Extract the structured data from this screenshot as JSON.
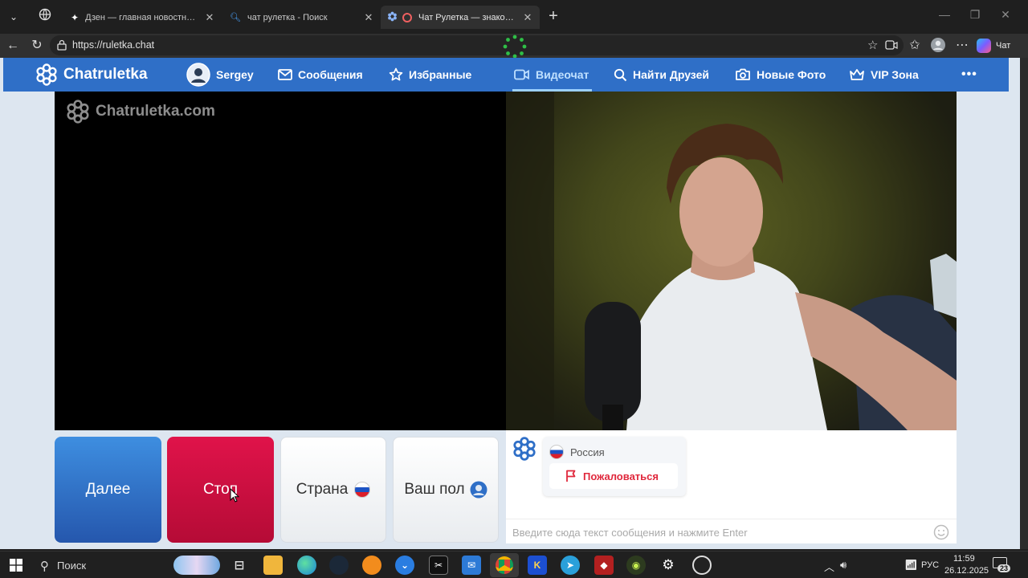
{
  "browser": {
    "tabs": [
      {
        "label": "Дзен — главная новостная инфо",
        "icon": "plus-star-icon"
      },
      {
        "label": "чат рулетка - Поиск",
        "icon": "search-icon"
      },
      {
        "label": "Чат Рулетка — знакомства и",
        "icon": "chatruletka-icon",
        "active": true
      }
    ],
    "url": "https://ruletka.chat",
    "profile_label": "Чат"
  },
  "site": {
    "logo": "Chatruletka",
    "nav": {
      "user": "Sergey",
      "messages": "Сообщения",
      "favorites": "Избранные",
      "videochat": "Видеочат",
      "find_friends": "Найти Друзей",
      "new_photos": "Новые Фото",
      "vip": "VIP Зона",
      "more": "•••"
    },
    "watermark": "Chatruletka.com",
    "controls": {
      "next": "Далее",
      "stop": "Стоп",
      "country": "Страна",
      "gender": "Ваш пол"
    },
    "chat": {
      "country": "Россия",
      "report": "Пожаловаться",
      "input_placeholder": "Введите сюда текст сообщения и нажмите Enter"
    }
  },
  "taskbar": {
    "search_label": "Поиск",
    "language": "РУС",
    "time": "11:59",
    "date": "26.12.2025",
    "notifications": "23"
  },
  "colors": {
    "brand_blue": "#2f6fc7",
    "next_button": "#2f6fce",
    "stop_button": "#d3103f",
    "report_red": "#e0283c"
  }
}
